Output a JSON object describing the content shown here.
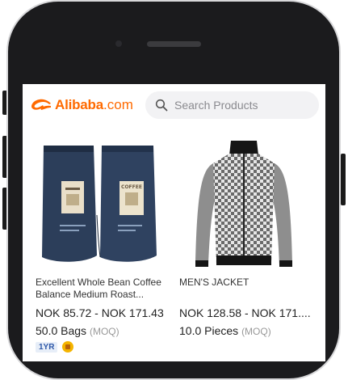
{
  "header": {
    "logo_text": "Alibaba",
    "logo_suffix": ".com",
    "search_placeholder": "Search Products"
  },
  "products": [
    {
      "title": "Excellent Whole Bean Coffee Balance Medium Roast...",
      "price": "NOK 85.72 - NOK 171.43",
      "moq_value": "50.0 Bags",
      "moq_label": "(MOQ)",
      "supplier_years": "1YR"
    },
    {
      "title": "MEN'S JACKET",
      "price": "NOK 128.58 - NOK 171....",
      "moq_value": "10.0 Pieces",
      "moq_label": "(MOQ)"
    }
  ],
  "coffee_bag_label": "COFFEE",
  "colors": {
    "brand": "#ff6a00",
    "bag": "#2c3e5a",
    "gold": "#f4b400"
  }
}
